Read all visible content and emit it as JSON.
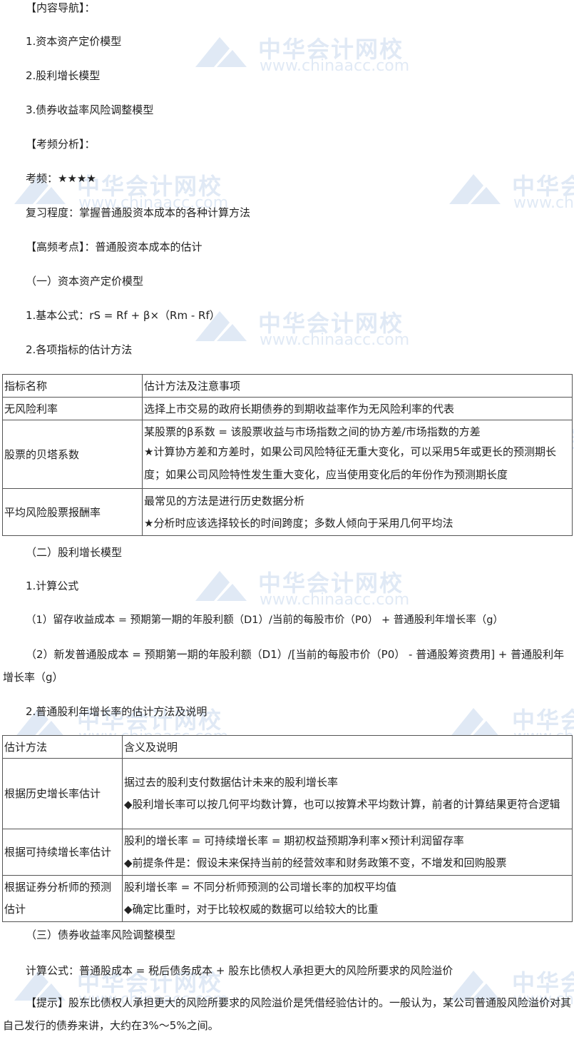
{
  "watermark": {
    "cn": "中华会计网校",
    "url": "www.chinaacc.com"
  },
  "lines": {
    "l1": "【内容导航】：",
    "l2": "1.资本资产定价模型",
    "l3": "2.股利增长模型",
    "l4": "3.债券收益率风险调整模型",
    "l5": "【考频分析】：",
    "l6": "考频：★★★★",
    "l7": "复习程度：掌握普通股资本成本的各种计算方法",
    "l8": "【高频考点】：普通股资本成本的估计",
    "l9": "（一）资本资产定价模型",
    "l10": "1.基本公式：rS = Rf + β×（Rm - Rf）",
    "l11": "2.各项指标的估计方法",
    "l12": "（二）股利增长模型",
    "l13": "1.计算公式",
    "l14": "（1）留存收益成本 = 预期第一期的年股利额（D1）/当前的每股市价（P0） + 普通股利年增长率（g）",
    "l15": "（2）新发普通股成本 = 预期第一期的年股利额（D1）/[当前的每股市价（P0） - 普通股筹资费用] + 普通股利年增长率（g）",
    "l16": "2.普通股利年增长率的估计方法及说明",
    "l17": "（三）债券收益率风险调整模型",
    "l18": "计算公式：普通股成本 = 税后债务成本 + 股东比债权人承担更大的风险所要求的风险溢价",
    "l19": "【提示】股东比债权人承担更大的风险所要求的风险溢价是凭借经验估计的。一般认为，某公司普通股风险溢价对其自己发行的债券来讲，大约在3%～5%之间。"
  },
  "table1": {
    "header": [
      "指标名称",
      "估计方法及注意事项"
    ],
    "rows": [
      {
        "name": "无风险利率",
        "desc": [
          "选择上市交易的政府长期债券的到期收益率作为无风险利率的代表"
        ]
      },
      {
        "name": "股票的贝塔系数",
        "desc": [
          "某股票的β系数 = 该股票收益与市场指数之间的协方差/市场指数的方差",
          "★计算协方差和方差时，如果公司风险特征无重大变化，可以采用5年或更长的预测期长度；如果公司风险特性发生重大变化，应当使用变化后的年份作为预测期长度"
        ]
      },
      {
        "name": "平均风险股票报酬率",
        "desc": [
          "最常见的方法是进行历史数据分析",
          "★分析时应该选择较长的时间跨度；多数人倾向于采用几何平均法"
        ]
      }
    ]
  },
  "table2": {
    "header": [
      "估计方法",
      "含义及说明"
    ],
    "rows": [
      {
        "name": "根据历史增长率估计",
        "desc": [
          "据过去的股利支付数据估计未来的股利增长率",
          "◆股利增长率可以按几何平均数计算，也可以按算术平均数计算，前者的计算结果更符合逻辑"
        ]
      },
      {
        "name": "根据可持续增长率估计",
        "desc": [
          "股利的增长率 = 可持续增长率 = 期初权益预期净利率×预计利润留存率",
          "◆前提条件是：假设未来保持当前的经营效率和财务政策不变，不增发和回购股票"
        ]
      },
      {
        "name": "根据证券分析师的预测估计",
        "desc": [
          "股利增长率 = 不同分析师预测的公司增长率的加权平均值",
          "◆确定比重时，对于比较权威的数据可以给较大的比重"
        ]
      }
    ]
  }
}
